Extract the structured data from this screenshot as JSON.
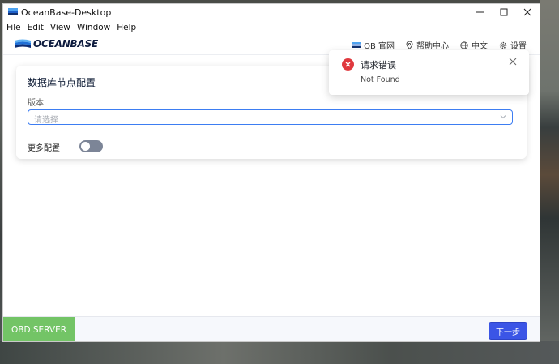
{
  "window": {
    "title": "OceanBase-Desktop",
    "minimize": "—",
    "maximize": "☐",
    "close": "✕"
  },
  "menu": [
    "File",
    "Edit",
    "View",
    "Window",
    "Help"
  ],
  "header": {
    "logo_text": "OCEANBASE",
    "links": {
      "ob_site": "OB 官网",
      "help": "帮助中心",
      "language": "中文",
      "settings": "设置"
    }
  },
  "card": {
    "title": "数据库节点配置",
    "version_label": "版本",
    "version_placeholder": "请选择",
    "more_config_label": "更多配置",
    "more_config_enabled": false
  },
  "toast": {
    "title": "请求错误",
    "message": "Not Found",
    "status_color": "#e0393e"
  },
  "footer": {
    "badge": "OBD SERVER",
    "next_button": "下一步"
  },
  "colors": {
    "accent": "#3b55e6",
    "badge": "#73c466"
  }
}
